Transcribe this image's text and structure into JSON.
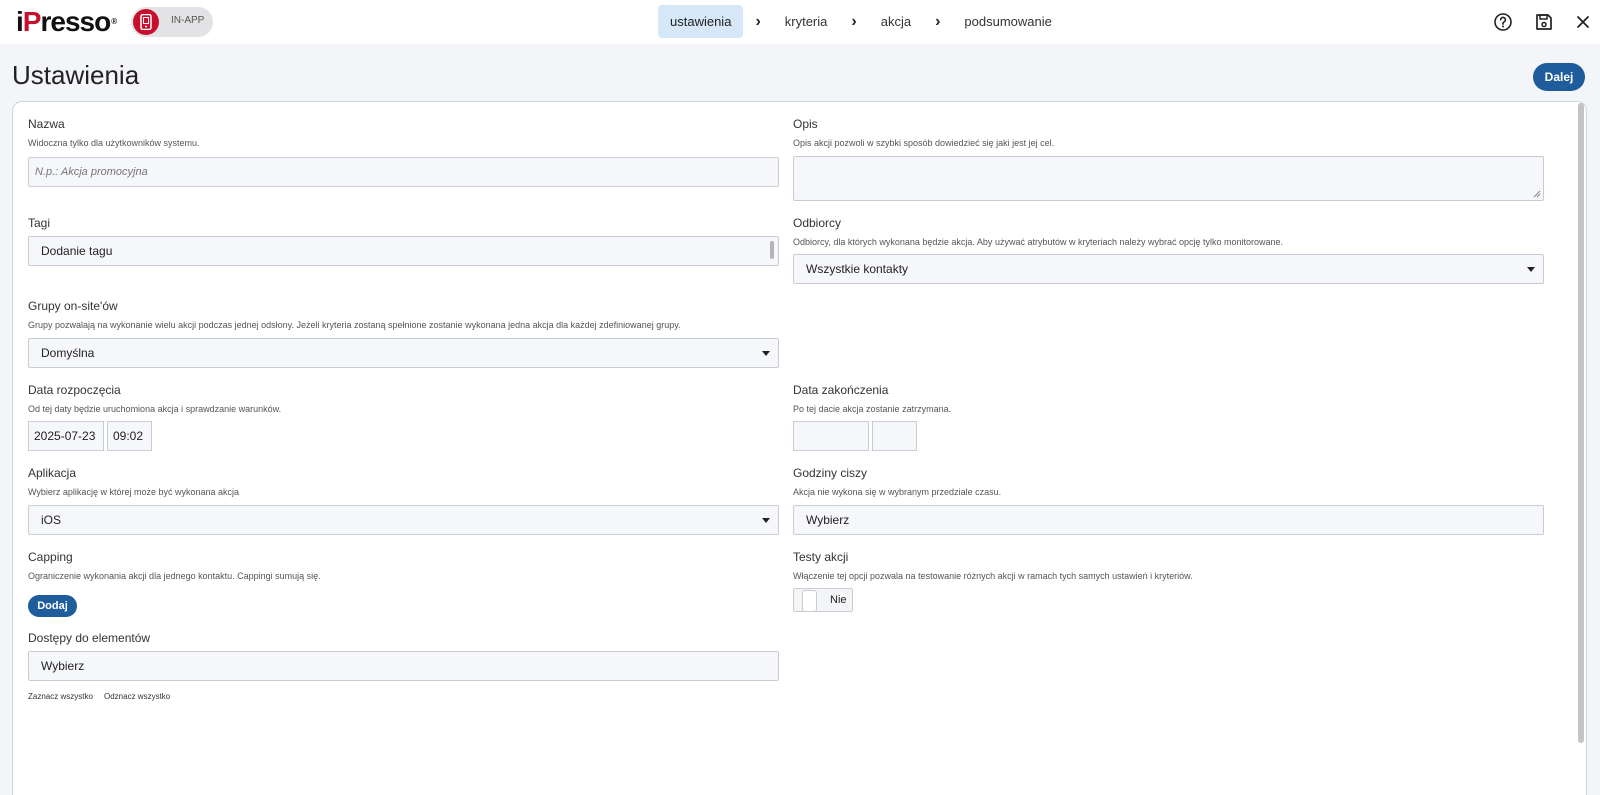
{
  "header": {
    "logo_text": "iPresso",
    "channel_badge": "IN-APP",
    "steps": [
      "ustawienia",
      "kryteria",
      "akcja",
      "podsumowanie"
    ],
    "icons": [
      "help-icon",
      "save-icon",
      "close-icon"
    ]
  },
  "page": {
    "title": "Ustawienia",
    "next_button": "Dalej"
  },
  "form": {
    "name": {
      "label": "Nazwa",
      "hint": "Widoczna tylko dla użytkowników systemu.",
      "placeholder": "N.p.: Akcja promocyjna",
      "value": ""
    },
    "description": {
      "label": "Opis",
      "hint": "Opis akcji pozwoli w szybki sposób dowiedzieć się jaki jest jej cel.",
      "value": ""
    },
    "tags": {
      "label": "Tagi",
      "value": "Dodanie tagu"
    },
    "recipients": {
      "label": "Odbiorcy",
      "hint": "Odbiorcy, dla których wykonana będzie akcja. Aby używać atrybutów w kryteriach należy wybrać opcję tylko monitorowane.",
      "value": "Wszystkie kontakty"
    },
    "onsite_groups": {
      "label": "Grupy on-site'ów",
      "hint": "Grupy pozwalają na wykonanie wielu akcji podczas jednej odsłony. Jeżeli kryteria zostaną spełnione zostanie wykonana jedna akcja dla każdej zdefiniowanej grupy.",
      "value": "Domyślna"
    },
    "start_date": {
      "label": "Data rozpoczęcia",
      "hint": "Od tej daty będzie uruchomiona akcja i sprawdzanie warunków.",
      "date": "2025-07-23",
      "time": "09:02"
    },
    "end_date": {
      "label": "Data zakończenia",
      "hint": "Po tej dacie akcja zostanie zatrzymana.",
      "date": "",
      "time": ""
    },
    "application": {
      "label": "Aplikacja",
      "hint": "Wybierz aplikację w której może być wykonana akcja",
      "value": "iOS"
    },
    "quiet_hours": {
      "label": "Godziny ciszy",
      "hint": "Akcja nie wykona się w wybranym przedziale czasu.",
      "value": "Wybierz"
    },
    "capping": {
      "label": "Capping",
      "hint": "Ograniczenie wykonania akcji dla jednego kontaktu. Cappingi sumują się.",
      "button": "Dodaj"
    },
    "action_tests": {
      "label": "Testy akcji",
      "hint": "Włączenie tej opcji pozwala na testowanie różnych akcji w ramach tych samych ustawień i kryteriów.",
      "toggle_value": "Nie"
    },
    "element_access": {
      "label": "Dostępy do elementów",
      "value": "Wybierz",
      "select_all": "Zaznacz wszystko",
      "deselect_all": "Odznacz wszystko"
    }
  }
}
